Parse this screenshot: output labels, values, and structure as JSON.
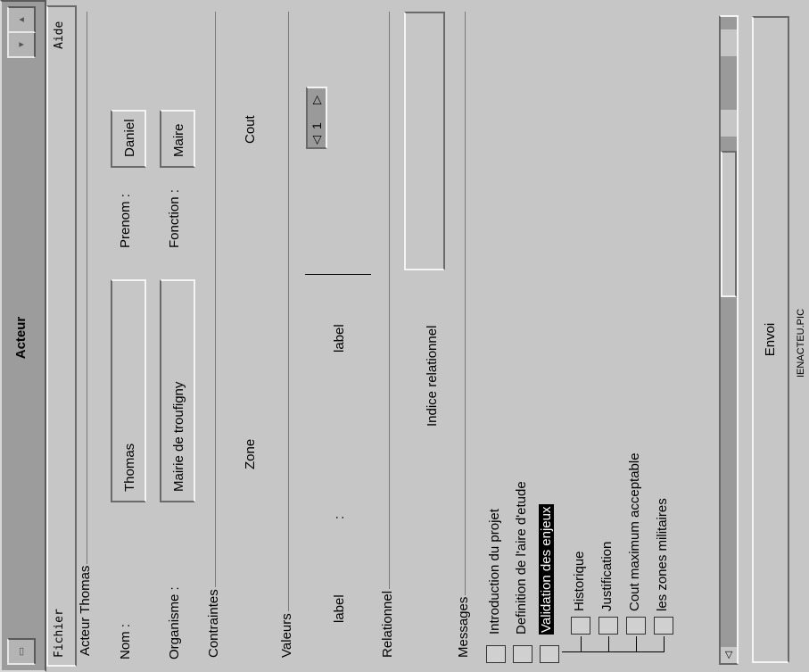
{
  "window": {
    "title": "Acteur",
    "status": "IENACTEU.PIC"
  },
  "menu": {
    "file": "Fichier",
    "help": "Aide"
  },
  "acteur": {
    "group_title": "Acteur Thomas",
    "nom_label": "Nom :",
    "nom_value": "Thomas",
    "prenom_label": "Prenom :",
    "prenom_value": "Daniel",
    "organisme_label": "Organisme :",
    "organisme_value": "Mairie de troufigny",
    "fonction_label": "Fonction :",
    "fonction_value": "Maire"
  },
  "contraintes": {
    "group_title": "Contraintes",
    "zone": "Zone",
    "cout": "Cout"
  },
  "valeurs": {
    "group_title": "Valeurs",
    "label_left": "label",
    "separator": ":",
    "label_mid": "label",
    "spinner_value": "1"
  },
  "relationnel": {
    "group_title": "Relationnel",
    "indice_label": "Indice relationnel"
  },
  "messages": {
    "group_title": "Messages",
    "items": [
      {
        "label": "Introduction du projet",
        "level": 0
      },
      {
        "label": "Definition de l'aire d'etude",
        "level": 0
      },
      {
        "label": "Validation des enjeux",
        "level": 0,
        "selected": true
      },
      {
        "label": "Historique",
        "level": 1
      },
      {
        "label": "Justification",
        "level": 1
      },
      {
        "label": "Cout maximum acceptable",
        "level": 1
      },
      {
        "label": "les zones militaires",
        "level": 1
      }
    ]
  },
  "send_button": "Envoi"
}
